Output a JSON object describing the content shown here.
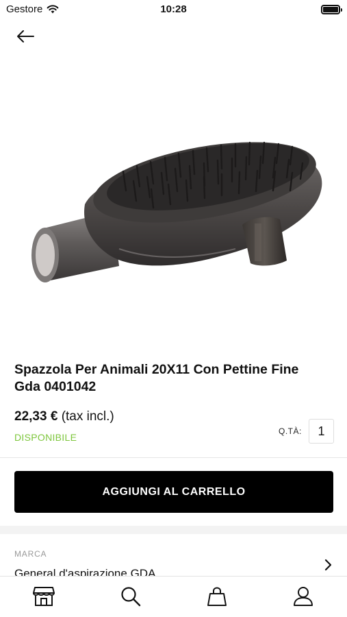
{
  "status_bar": {
    "carrier": "Gestore",
    "time": "10:28"
  },
  "product": {
    "title": "Spazzola Per Animali 20X11 Con Pettine Fine Gda 0401042",
    "price": "22,33 €",
    "price_suffix": "(tax incl.)",
    "availability": "DISPONIBILE",
    "image_alt": "pet-brush-product-image"
  },
  "quantity": {
    "label": "Q.TÀ:",
    "value": "1"
  },
  "actions": {
    "add_to_cart": "AGGIUNGI AL CARRELLO"
  },
  "details": {
    "brand_label": "MARCA",
    "brand_value": "General d'aspirazione GDA"
  },
  "tab_bar": {
    "items": [
      {
        "icon": "store-icon"
      },
      {
        "icon": "search-icon"
      },
      {
        "icon": "shopping-bag-icon"
      },
      {
        "icon": "user-icon"
      }
    ]
  },
  "colors": {
    "availability": "#7cc63a",
    "primary_button": "#000000"
  }
}
